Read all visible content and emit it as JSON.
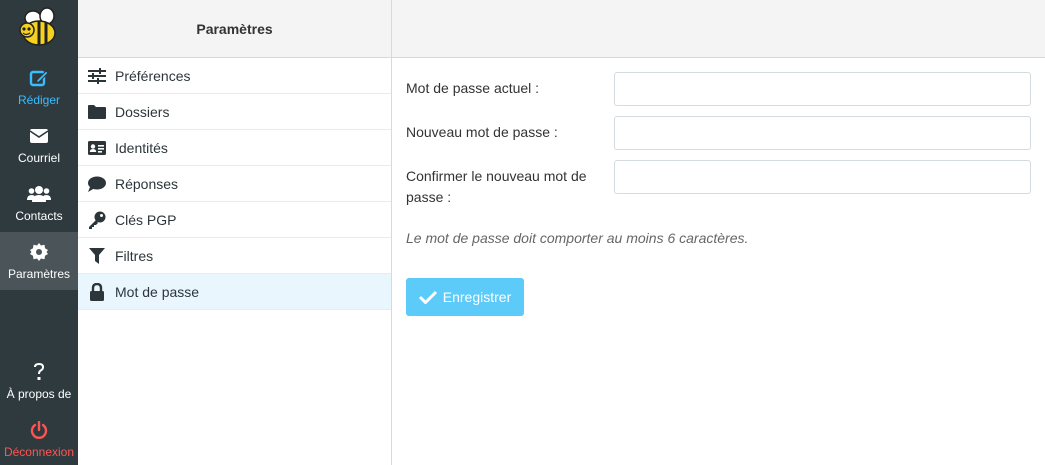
{
  "nav": {
    "items": [
      {
        "label": "Rédiger",
        "icon": "compose-icon"
      },
      {
        "label": "Courriel",
        "icon": "envelope-icon"
      },
      {
        "label": "Contacts",
        "icon": "users-icon"
      },
      {
        "label": "Paramètres",
        "icon": "gear-icon"
      },
      {
        "label": "À propos de",
        "icon": "question-icon"
      },
      {
        "label": "Déconnexion",
        "icon": "power-icon"
      }
    ],
    "colors": {
      "background": "#2f3a3f",
      "active": "#37beff",
      "logout": "#ff5552"
    }
  },
  "settings": {
    "title": "Paramètres",
    "items": [
      {
        "label": "Préférences",
        "icon": "sliders-icon"
      },
      {
        "label": "Dossiers",
        "icon": "folder-icon"
      },
      {
        "label": "Identités",
        "icon": "id-card-icon"
      },
      {
        "label": "Réponses",
        "icon": "comment-icon"
      },
      {
        "label": "Clés PGP",
        "icon": "key-icon"
      },
      {
        "label": "Filtres",
        "icon": "filter-icon"
      },
      {
        "label": "Mot de passe",
        "icon": "lock-icon",
        "selected": true
      }
    ]
  },
  "password_form": {
    "current_label": "Mot de passe actuel :",
    "current_value": "",
    "new_label": "Nouveau mot de passe :",
    "new_value": "",
    "confirm_label": "Confirmer le nouveau mot de passe :",
    "confirm_value": "",
    "hint": "Le mot de passe doit comporter au moins 6 caractères.",
    "save_label": "Enregistrer",
    "button_color": "#5ccbfa"
  }
}
